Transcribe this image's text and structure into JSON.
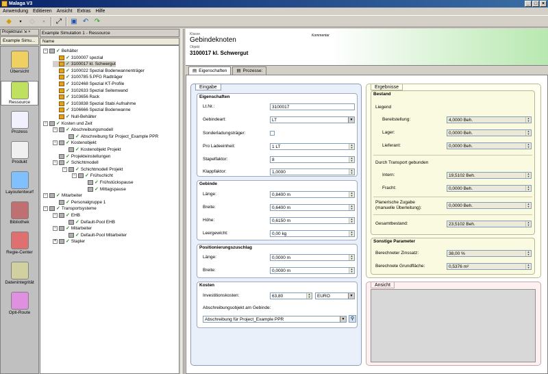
{
  "app": {
    "title": "Malaga V3",
    "controls": [
      "_",
      "□",
      "×"
    ]
  },
  "menu": [
    "Anwendung",
    "Editieren",
    "Ansicht",
    "Extras",
    "Hilfe"
  ],
  "nav": {
    "header": "Projektnavi",
    "tab": "Example Simu...",
    "items": [
      {
        "label": "Übersicht",
        "icon": "overview-icon",
        "color": "#f0d060"
      },
      {
        "label": "Ressource",
        "icon": "resource-icon",
        "color": "#c0e060"
      },
      {
        "label": "Prozess",
        "icon": "process-icon",
        "color": "#f0f0ff"
      },
      {
        "label": "Produkt",
        "icon": "product-icon",
        "color": "#f0f0f0"
      },
      {
        "label": "Layoutentwurf",
        "icon": "layout-icon",
        "color": "#80c0ff"
      },
      {
        "label": "Bibliothek",
        "icon": "library-icon",
        "color": "#c07070"
      },
      {
        "label": "Regie-Center",
        "icon": "regie-center-icon",
        "color": "#e07070"
      },
      {
        "label": "Datenintegrität",
        "icon": "data-quality-icon",
        "color": "#d0d0a0"
      },
      {
        "label": "Opti-Route",
        "icon": "opti-route-icon",
        "color": "#e090e0"
      }
    ]
  },
  "tree": {
    "header": "Example Simulation 1 - Ressource",
    "column": "Name",
    "nodes": [
      {
        "label": "Behälter",
        "x": 4,
        "exp": "−",
        "icon": "folder"
      },
      {
        "label": "3100007 spezial",
        "x": 18,
        "icon": "box"
      },
      {
        "label": "3100017 kl. Schwergut",
        "x": 18,
        "icon": "box",
        "sel": true
      },
      {
        "label": "3100022 Spezial Bodenwannenträger",
        "x": 18,
        "icon": "box"
      },
      {
        "label": "3100785 5.PFG Radträger",
        "x": 18,
        "icon": "box"
      },
      {
        "label": "3102468 Spezial KT-Profile",
        "x": 18,
        "icon": "box"
      },
      {
        "label": "3102633 Spezial Seitenwand",
        "x": 18,
        "icon": "box"
      },
      {
        "label": "3103656 Rack",
        "x": 18,
        "icon": "box"
      },
      {
        "label": "3103838 Spezial  Stabi Aufnahme",
        "x": 18,
        "icon": "box"
      },
      {
        "label": "3106666 Spezial Bodenwanne",
        "x": 18,
        "icon": "box"
      },
      {
        "label": "Null-Behälter",
        "x": 18,
        "icon": "box"
      },
      {
        "label": "Kosten und Zeit",
        "x": 4,
        "exp": "−",
        "icon": "folder"
      },
      {
        "label": "Abschreibungsmodell",
        "x": 18,
        "exp": "−",
        "icon": "folder"
      },
      {
        "label": "Abschreibung für Project_Example PPR",
        "x": 32,
        "icon": "doc"
      },
      {
        "label": "Kostenobjekt",
        "x": 18,
        "exp": "−",
        "icon": "folder"
      },
      {
        "label": "Kostenobjekt Projekt",
        "x": 32,
        "icon": "doc"
      },
      {
        "label": "Projekteinstellungen",
        "x": 18,
        "icon": "doc"
      },
      {
        "label": "Schichtmodell",
        "x": 18,
        "exp": "−",
        "icon": "folder"
      },
      {
        "label": "Schichtmodell Projekt",
        "x": 32,
        "exp": "−",
        "icon": "doc"
      },
      {
        "label": "Frühschicht",
        "x": 46,
        "exp": "−",
        "icon": "doc"
      },
      {
        "label": "Frühstückspause",
        "x": 60,
        "icon": "doc"
      },
      {
        "label": "Mittagspause",
        "x": 60,
        "icon": "doc"
      },
      {
        "label": "Mitarbeiter",
        "x": 4,
        "exp": "−",
        "icon": "folder"
      },
      {
        "label": "Personalgruppe 1",
        "x": 18,
        "icon": "doc"
      },
      {
        "label": "Transportsysteme",
        "x": 4,
        "exp": "−",
        "icon": "folder"
      },
      {
        "label": "EHB",
        "x": 18,
        "exp": "−",
        "icon": "folder"
      },
      {
        "label": "Default-Pool EHB",
        "x": 32,
        "icon": "doc"
      },
      {
        "label": "Mitarbeiter",
        "x": 18,
        "exp": "−",
        "icon": "folder"
      },
      {
        "label": "Default-Pool Mitarbeiter",
        "x": 32,
        "icon": "doc"
      },
      {
        "label": "Stapler",
        "x": 18,
        "exp": "+",
        "icon": "folder"
      }
    ]
  },
  "header": {
    "category": "Klasse",
    "title": "Gebindeknoten",
    "obj_caption": "Objekt",
    "obj_name": "3100017 kl. Schwergut",
    "komment": "Kommentar"
  },
  "tabs": [
    "Eigenschaften",
    "Prozesse:"
  ],
  "eingabe": {
    "title": "Eingabe",
    "eigenschaften": {
      "title": "Eigenschaften",
      "ltnr_label": "Lt.Nr.:",
      "ltnr": "3100017",
      "gebindeart_label": "Gebindeart:",
      "gebindeart": "LT",
      "sonder_label": "Sonderladungsträger:",
      "proladeeinheit_label": "Pro Ladeeinheit:",
      "proladeeinheit": "1 LT",
      "stapelfaktor_label": "Stapelfaktor:",
      "stapelfaktor": "8",
      "klappfaktor_label": "Klappfaktor:",
      "klappfaktor": "1,0000"
    },
    "gebinde": {
      "title": "Gebinde",
      "laenge_label": "Länge:",
      "laenge": "0,8400 m",
      "breite_label": "Breite:",
      "breite": "0,6400 m",
      "hoehe_label": "Höhe:",
      "hoehe": "0,6150 m",
      "leergewicht_label": "Leergewicht:",
      "leergewicht": "0,00 kg"
    },
    "pos": {
      "title": "Positionierungszuschlag",
      "laenge_label": "Länge:",
      "laenge": "0,0000 m",
      "breite_label": "Breite:",
      "breite": "0,0000 m"
    },
    "kosten": {
      "title": "Kosten",
      "invest_label": "Investitionskosten:",
      "invest": "63,80",
      "currency": "EURO",
      "abschr_label": "Abschreibungsobjekt am Gebinde:",
      "abschr": "Abschreibung für Project_Example PPR"
    }
  },
  "ergebnisse": {
    "title": "Ergebnisse",
    "bestand": {
      "title": "Bestand",
      "liegend": "Liegend",
      "bereit_label": "Bereitstellung:",
      "bereit": "4,0000 Beh.",
      "lager_label": "Lager:",
      "lager": "0,0000 Beh.",
      "lieferant_label": "Lieferant:",
      "lieferant": "0,0000 Beh.",
      "durch": "Durch Transport gebunden",
      "intern_label": "Intern:",
      "intern": "19,5102 Beh.",
      "fracht_label": "Fracht:",
      "fracht": "0,0000 Beh.",
      "plan_label1": "Planerische Zugabe",
      "plan_label2": "(manuelle Überleitung):",
      "plan": "0,0000 Beh.",
      "gesamt_label": "Gesamtbestand:",
      "gesamt": "23,5102 Beh."
    },
    "sonstige": {
      "title": "Sonstige Parameter",
      "zins_label": "Berechneter Zinssatz:",
      "zins": "38,00 %",
      "grund_label": "Berechnete Grundfläche:",
      "grund": "0,5376 m²"
    }
  },
  "ansicht": {
    "title": "Ansicht"
  }
}
